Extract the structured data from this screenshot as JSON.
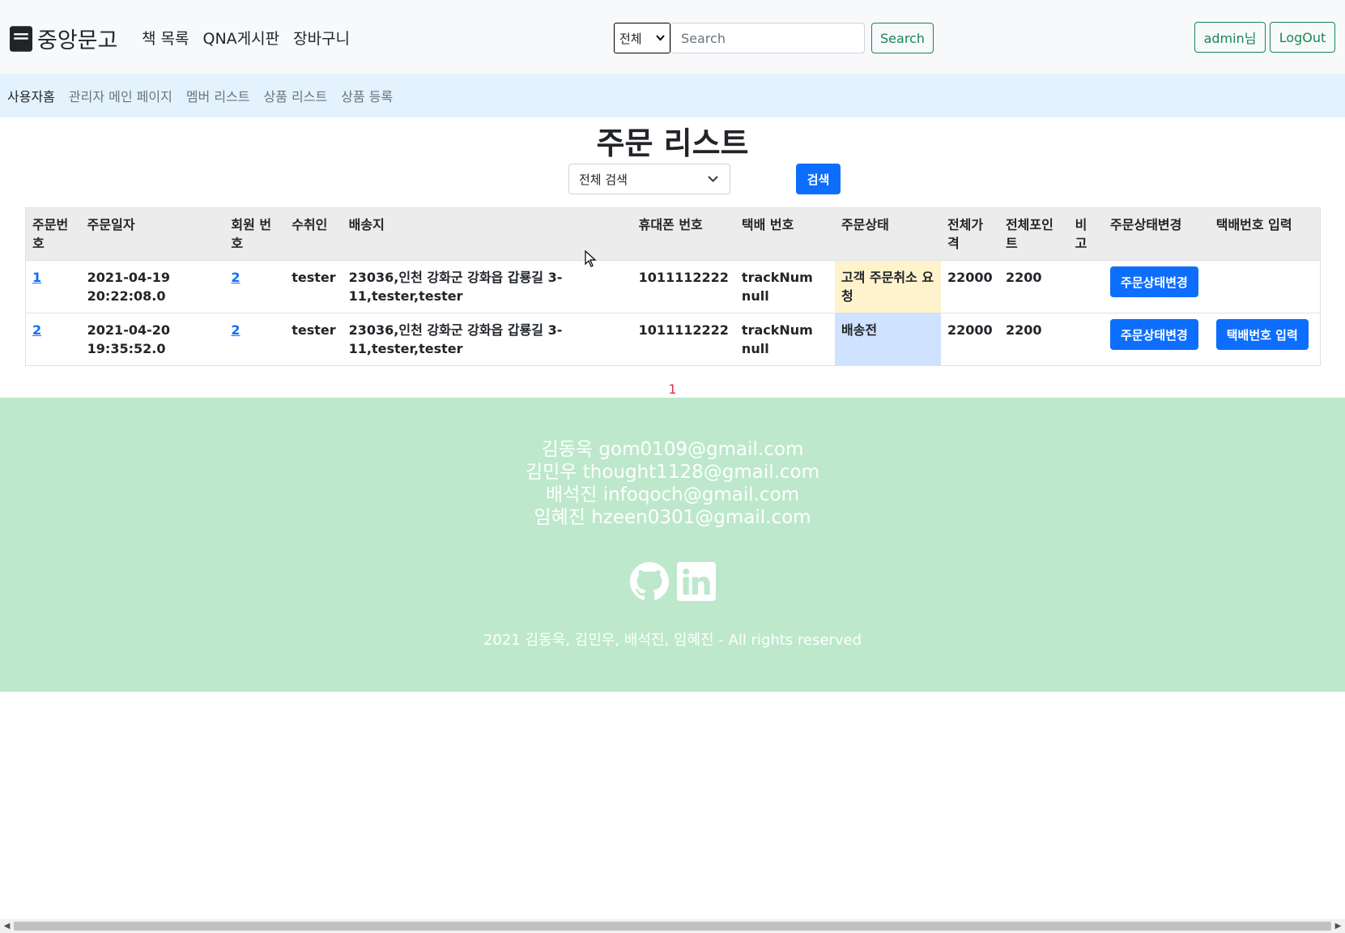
{
  "navbar": {
    "brand": "중앙문고",
    "links": [
      "책 목록",
      "QNA게시판",
      "장바구니"
    ],
    "search_select": "전체",
    "search_placeholder": "Search",
    "search_button": "Search",
    "user_button": "admin님",
    "logout_button": "LogOut"
  },
  "subnav": {
    "links": [
      "사용자홈",
      "관리자 메인 페이지",
      "멤버 리스트",
      "상품 리스트",
      "상품 등록"
    ]
  },
  "page": {
    "title": "주문 리스트",
    "filter_select": "전체 검색",
    "filter_button": "검색"
  },
  "table": {
    "headers": [
      "주문번호",
      "주문일자",
      "회원 번호",
      "수취인",
      "배송지",
      "휴대폰 번호",
      "택배 번호",
      "주문상태",
      "전체가격",
      "전체포인트",
      "비고",
      "주문상태변경",
      "택배번호 입력"
    ],
    "rows": [
      {
        "order_no": "1",
        "date": "2021-04-19 20:22:08.0",
        "member_no": "2",
        "recipient": "tester",
        "address": "23036,인천 강화군 강화읍 갑룡길 3-11,tester,tester",
        "phone": "1011112222",
        "tracking": "trackNum null",
        "status": "고객 주문취소 요청",
        "status_color": "#fff3cd",
        "total_price": "22000",
        "total_point": "2200",
        "note": "",
        "change_button": "주문상태변경",
        "tracking_button": ""
      },
      {
        "order_no": "2",
        "date": "2021-04-20 19:35:52.0",
        "member_no": "2",
        "recipient": "tester",
        "address": "23036,인천 강화군 강화읍 갑룡길 3-11,tester,tester",
        "phone": "1011112222",
        "tracking": "trackNum null",
        "status": "배송전",
        "status_color": "#cfe2ff",
        "total_price": "22000",
        "total_point": "2200",
        "note": "",
        "change_button": "주문상태변경",
        "tracking_button": "택배번호 입력"
      }
    ]
  },
  "pagination": {
    "current": "1"
  },
  "footer": {
    "contacts": [
      "김동욱 gom0109@gmail.com",
      "김민우 thought1128@gmail.com",
      "배석진 infoqoch@gmail.com",
      "임혜진 hzeen0301@gmail.com"
    ],
    "social_icons": [
      "github-icon",
      "linkedin-icon"
    ],
    "copyright": "2021 김동욱, 김민우, 배석진, 임혜진 - All rights reserved"
  },
  "colors": {
    "navbar_bg": "#f8f9fa",
    "subnav_bg": "#e3f2fd",
    "footer_bg": "#bde8cb",
    "primary": "#0d6efd",
    "success": "#198754"
  }
}
